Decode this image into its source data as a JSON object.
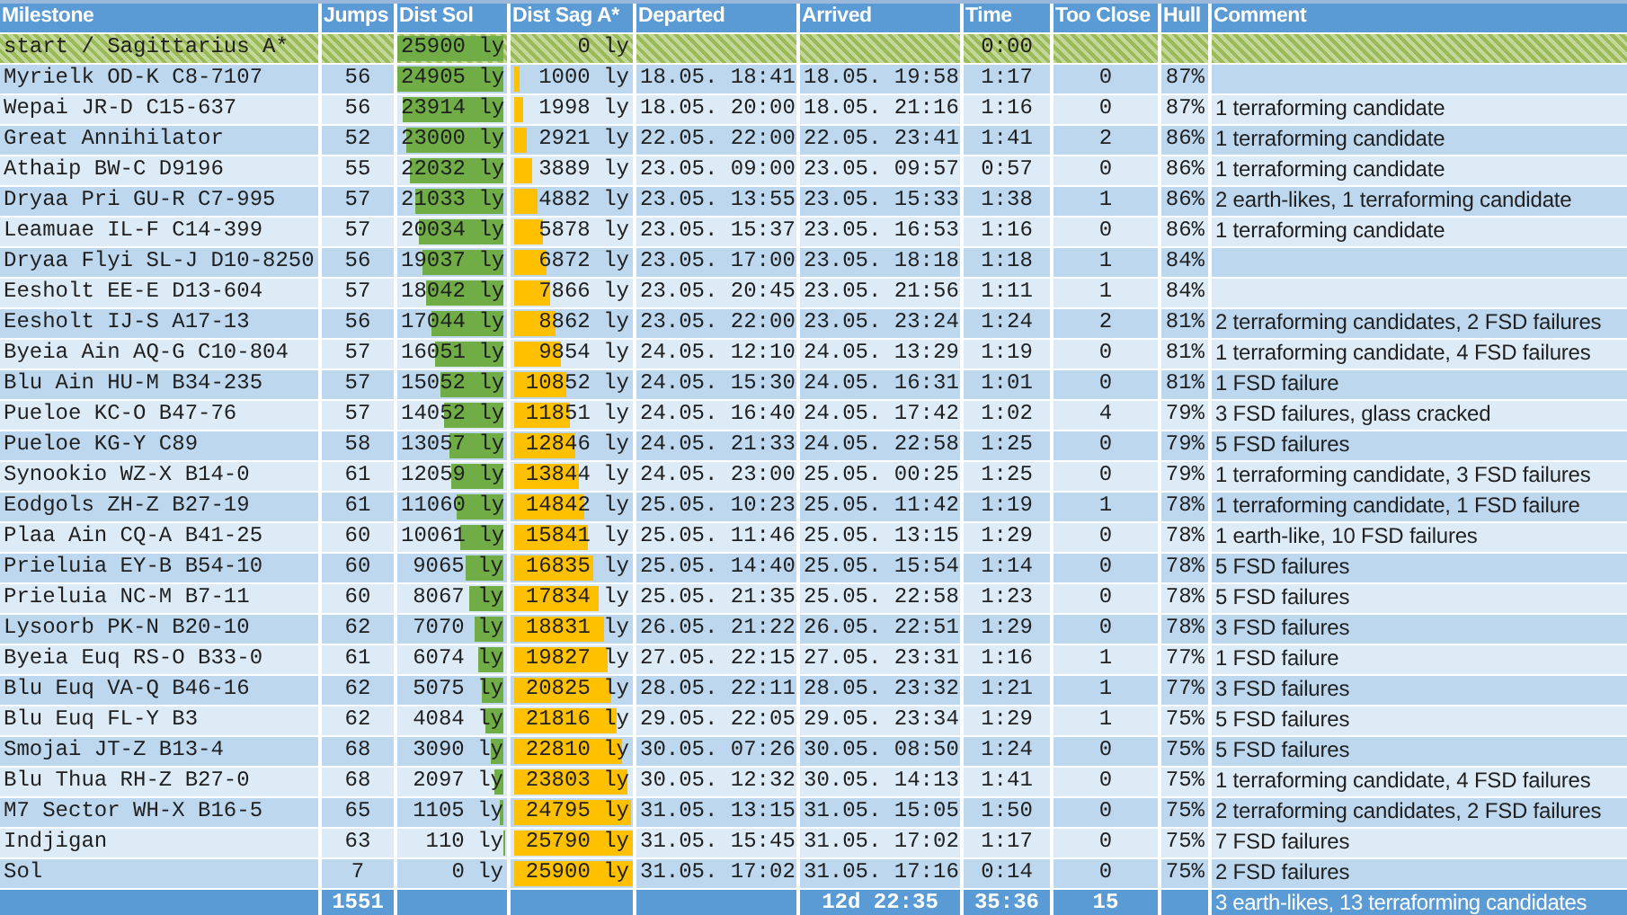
{
  "table": {
    "columns": [
      "Milestone",
      "Jumps",
      "Dist Sol",
      "Dist Sag A*",
      "Departed",
      "Arrived",
      "Time",
      "Too Close",
      "Hull",
      "Comment"
    ],
    "rows": [
      {
        "kind": "start",
        "milestone": "start / Sagittarius A*",
        "dist_sol": {
          "text": "25900 ly",
          "level": 1
        },
        "dist_sag": {
          "text": "0 ly"
        },
        "time": "0:00"
      },
      {
        "kind": "leg",
        "milestone": "Myrielk OD-K C8-7107",
        "jumps": "56",
        "dist_sol": {
          "text": "24905 ly",
          "level": 0.96
        },
        "dist_sag": {
          "text": "1000 ly",
          "level": 0.04
        },
        "departed": "18.05. 18:41",
        "arrived": "18.05. 19:58",
        "time": "1:17",
        "too_close": "0",
        "hull": "87%"
      },
      {
        "kind": "leg",
        "milestone": "Wepai JR-D C15-637",
        "jumps": "56",
        "dist_sol": {
          "text": "23914 ly",
          "level": 0.92
        },
        "dist_sag": {
          "text": "1998 ly",
          "level": 0.08
        },
        "departed": "18.05. 20:00",
        "arrived": "18.05. 21:16",
        "time": "1:16",
        "too_close": "0",
        "hull": "87%",
        "comment": "1 terraforming candidate"
      },
      {
        "kind": "leg",
        "milestone": "Great Annihilator",
        "jumps": "52",
        "dist_sol": {
          "text": "23000 ly",
          "level": 0.89
        },
        "dist_sag": {
          "text": "2921 ly",
          "level": 0.11
        },
        "departed": "22.05. 22:00",
        "arrived": "22.05. 23:41",
        "time": "1:41",
        "too_close": "2",
        "hull": "86%",
        "comment": "1 terraforming candidate"
      },
      {
        "kind": "leg",
        "milestone": "Athaip BW-C D9196",
        "jumps": "55",
        "dist_sol": {
          "text": "22032 ly",
          "level": 0.85
        },
        "dist_sag": {
          "text": "3889 ly",
          "level": 0.15
        },
        "departed": "23.05. 09:00",
        "arrived": "23.05. 09:57",
        "time": "0:57",
        "too_close": "0",
        "hull": "86%",
        "comment": "1 terraforming candidate"
      },
      {
        "kind": "leg",
        "milestone": "Dryaa Pri GU-R C7-995",
        "jumps": "57",
        "dist_sol": {
          "text": "21033 ly",
          "level": 0.81
        },
        "dist_sag": {
          "text": "4882 ly",
          "level": 0.19
        },
        "departed": "23.05. 13:55",
        "arrived": "23.05. 15:33",
        "time": "1:38",
        "too_close": "1",
        "hull": "86%",
        "comment": "2 earth-likes, 1 terraforming candidate"
      },
      {
        "kind": "leg",
        "milestone": "Leamuae IL-F C14-399",
        "jumps": "57",
        "dist_sol": {
          "text": "20034 ly",
          "level": 0.77
        },
        "dist_sag": {
          "text": "5878 ly",
          "level": 0.23
        },
        "departed": "23.05. 15:37",
        "arrived": "23.05. 16:53",
        "time": "1:16",
        "too_close": "0",
        "hull": "86%",
        "comment": "1 terraforming candidate"
      },
      {
        "kind": "leg",
        "milestone": "Dryaa Flyi SL-J D10-8250",
        "jumps": "56",
        "dist_sol": {
          "text": "19037 ly",
          "level": 0.74
        },
        "dist_sag": {
          "text": "6872 ly",
          "level": 0.27
        },
        "departed": "23.05. 17:00",
        "arrived": "23.05. 18:18",
        "time": "1:18",
        "too_close": "1",
        "hull": "84%"
      },
      {
        "kind": "leg",
        "milestone": "Eesholt EE-E D13-604",
        "jumps": "57",
        "dist_sol": {
          "text": "18042 ly",
          "level": 0.7
        },
        "dist_sag": {
          "text": "7866 ly",
          "level": 0.3
        },
        "departed": "23.05. 20:45",
        "arrived": "23.05. 21:56",
        "time": "1:11",
        "too_close": "1",
        "hull": "84%"
      },
      {
        "kind": "leg",
        "milestone": "Eesholt IJ-S A17-13",
        "jumps": "56",
        "dist_sol": {
          "text": "17044 ly",
          "level": 0.66
        },
        "dist_sag": {
          "text": "8862 ly",
          "level": 0.34
        },
        "departed": "23.05. 22:00",
        "arrived": "23.05. 23:24",
        "time": "1:24",
        "too_close": "2",
        "hull": "81%",
        "comment": "2 terraforming candidates, 2 FSD failures"
      },
      {
        "kind": "leg",
        "milestone": "Byeia Ain AQ-G C10-804",
        "jumps": "57",
        "dist_sol": {
          "text": "16051 ly",
          "level": 0.62
        },
        "dist_sag": {
          "text": "9854 ly",
          "level": 0.38
        },
        "departed": "24.05. 12:10",
        "arrived": "24.05. 13:29",
        "time": "1:19",
        "too_close": "0",
        "hull": "81%",
        "comment": "1 terraforming candidate, 4 FSD failures"
      },
      {
        "kind": "leg",
        "milestone": "Blu Ain HU-M B34-235",
        "jumps": "57",
        "dist_sol": {
          "text": "15052 ly",
          "level": 0.58
        },
        "dist_sag": {
          "text": "10852 ly",
          "level": 0.42
        },
        "departed": "24.05. 15:30",
        "arrived": "24.05. 16:31",
        "time": "1:01",
        "too_close": "0",
        "hull": "81%",
        "comment": "1 FSD failure"
      },
      {
        "kind": "leg",
        "milestone": "Pueloe KC-O B47-76",
        "jumps": "57",
        "dist_sol": {
          "text": "14052 ly",
          "level": 0.54
        },
        "dist_sag": {
          "text": "11851 ly",
          "level": 0.46
        },
        "departed": "24.05. 16:40",
        "arrived": "24.05. 17:42",
        "time": "1:02",
        "too_close": "4",
        "hull": "79%",
        "comment": "3 FSD failures, glass cracked"
      },
      {
        "kind": "leg",
        "milestone": "Pueloe KG-Y C89",
        "jumps": "58",
        "dist_sol": {
          "text": "13057 ly",
          "level": 0.5
        },
        "dist_sag": {
          "text": "12846 ly",
          "level": 0.5
        },
        "departed": "24.05. 21:33",
        "arrived": "24.05. 22:58",
        "time": "1:25",
        "too_close": "0",
        "hull": "79%",
        "comment": "5 FSD failures"
      },
      {
        "kind": "leg",
        "milestone": "Synookio WZ-X B14-0",
        "jumps": "61",
        "dist_sol": {
          "text": "12059 ly",
          "level": 0.47
        },
        "dist_sag": {
          "text": "13844 ly",
          "level": 0.53
        },
        "departed": "24.05. 23:00",
        "arrived": "25.05. 00:25",
        "time": "1:25",
        "too_close": "0",
        "hull": "79%",
        "comment": "1 terraforming candidate, 3 FSD failures"
      },
      {
        "kind": "leg",
        "milestone": "Eodgols ZH-Z B27-19",
        "jumps": "61",
        "dist_sol": {
          "text": "11060 ly",
          "level": 0.43
        },
        "dist_sag": {
          "text": "14842 ly",
          "level": 0.57
        },
        "departed": "25.05. 10:23",
        "arrived": "25.05. 11:42",
        "time": "1:19",
        "too_close": "1",
        "hull": "78%",
        "comment": "1 terraforming candidate, 1 FSD failure"
      },
      {
        "kind": "leg",
        "milestone": "Plaa Ain CQ-A B41-25",
        "jumps": "60",
        "dist_sol": {
          "text": "10061 ly",
          "level": 0.39
        },
        "dist_sag": {
          "text": "15841 ly",
          "level": 0.61
        },
        "departed": "25.05. 11:46",
        "arrived": "25.05. 13:15",
        "time": "1:29",
        "too_close": "0",
        "hull": "78%",
        "comment": "1 earth-like, 10 FSD failures"
      },
      {
        "kind": "leg",
        "milestone": "Prieluia EY-B B54-10",
        "jumps": "60",
        "dist_sol": {
          "text": "9065 ly",
          "level": 0.35
        },
        "dist_sag": {
          "text": "16835 ly",
          "level": 0.65
        },
        "departed": "25.05. 14:40",
        "arrived": "25.05. 15:54",
        "time": "1:14",
        "too_close": "0",
        "hull": "78%",
        "comment": "5 FSD failures"
      },
      {
        "kind": "leg",
        "milestone": "Prieluia NC-M B7-11",
        "jumps": "60",
        "dist_sol": {
          "text": "8067 ly",
          "level": 0.31
        },
        "dist_sag": {
          "text": "17834 ly",
          "level": 0.69
        },
        "departed": "25.05. 21:35",
        "arrived": "25.05. 22:58",
        "time": "1:23",
        "too_close": "0",
        "hull": "78%",
        "comment": "5 FSD failures"
      },
      {
        "kind": "leg",
        "milestone": "Lysoorb PK-N B20-10",
        "jumps": "62",
        "dist_sol": {
          "text": "7070 ly",
          "level": 0.27
        },
        "dist_sag": {
          "text": "18831 ly",
          "level": 0.73
        },
        "departed": "26.05. 21:22",
        "arrived": "26.05. 22:51",
        "time": "1:29",
        "too_close": "0",
        "hull": "78%",
        "comment": "3 FSD failures"
      },
      {
        "kind": "leg",
        "milestone": "Byeia Euq RS-O B33-0",
        "jumps": "61",
        "dist_sol": {
          "text": "6074 ly",
          "level": 0.23
        },
        "dist_sag": {
          "text": "19827 ly",
          "level": 0.77
        },
        "departed": "27.05. 22:15",
        "arrived": "27.05. 23:31",
        "time": "1:16",
        "too_close": "1",
        "hull": "77%",
        "comment": "1 FSD failure"
      },
      {
        "kind": "leg",
        "milestone": "Blu Euq VA-Q B46-16",
        "jumps": "62",
        "dist_sol": {
          "text": "5075 ly",
          "level": 0.2
        },
        "dist_sag": {
          "text": "20825 ly",
          "level": 0.8
        },
        "departed": "28.05. 22:11",
        "arrived": "28.05. 23:32",
        "time": "1:21",
        "too_close": "1",
        "hull": "77%",
        "comment": "3 FSD failures"
      },
      {
        "kind": "leg",
        "milestone": "Blu Euq FL-Y B3",
        "jumps": "62",
        "dist_sol": {
          "text": "4084 ly",
          "level": 0.16
        },
        "dist_sag": {
          "text": "21816 ly",
          "level": 0.84
        },
        "departed": "29.05. 22:05",
        "arrived": "29.05. 23:34",
        "time": "1:29",
        "too_close": "1",
        "hull": "75%",
        "comment": "5 FSD failures"
      },
      {
        "kind": "leg",
        "milestone": "Smojai JT-Z B13-4",
        "jumps": "68",
        "dist_sol": {
          "text": "3090 ly",
          "level": 0.12
        },
        "dist_sag": {
          "text": "22810 ly",
          "level": 0.88
        },
        "departed": "30.05. 07:26",
        "arrived": "30.05. 08:50",
        "time": "1:24",
        "too_close": "0",
        "hull": "75%",
        "comment": "5 FSD failures"
      },
      {
        "kind": "leg",
        "milestone": "Blu Thua RH-Z B27-0",
        "jumps": "68",
        "dist_sol": {
          "text": "2097 ly",
          "level": 0.08
        },
        "dist_sag": {
          "text": "23803 ly",
          "level": 0.92
        },
        "departed": "30.05. 12:32",
        "arrived": "30.05. 14:13",
        "time": "1:41",
        "too_close": "0",
        "hull": "75%",
        "comment": "1 terraforming candidate, 4 FSD failures"
      },
      {
        "kind": "leg",
        "milestone": "M7 Sector WH-X B16-5",
        "jumps": "65",
        "dist_sol": {
          "text": "1105 ly",
          "level": 0.04
        },
        "dist_sag": {
          "text": "24795 ly",
          "level": 0.96
        },
        "departed": "31.05. 13:15",
        "arrived": "31.05. 15:05",
        "time": "1:50",
        "too_close": "0",
        "hull": "75%",
        "comment": "2 terraforming candidates, 2 FSD failures"
      },
      {
        "kind": "leg",
        "milestone": "Indjigan",
        "jumps": "63",
        "dist_sol": {
          "text": "110 ly",
          "level": 0.004
        },
        "dist_sag": {
          "text": "25790 ly",
          "level": 1
        },
        "departed": "31.05. 15:45",
        "arrived": "31.05. 17:02",
        "time": "1:17",
        "too_close": "0",
        "hull": "75%",
        "comment": "7 FSD failures"
      },
      {
        "kind": "leg",
        "milestone": "Sol",
        "jumps": "7",
        "dist_sol": {
          "text": "0 ly"
        },
        "dist_sag": {
          "text": "25900 ly",
          "level": 1
        },
        "departed": "31.05. 17:02",
        "arrived": "31.05. 17:16",
        "time": "0:14",
        "too_close": "0",
        "hull": "75%",
        "comment": "2 FSD failures"
      }
    ],
    "totals": {
      "jumps": "1551",
      "arrived": "12d 22:35",
      "time": "35:36",
      "too_close": "15",
      "comment": "3 earth-likes, 13 terraforming candidates"
    }
  }
}
